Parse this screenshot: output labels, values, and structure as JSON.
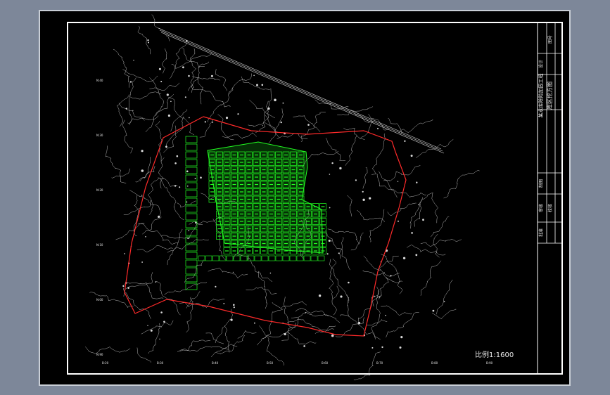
{
  "scale_label": "比例1:1600",
  "title_block": {
    "drawing_title": "库区挖方图",
    "project_name": "某水库除险加固工程",
    "row_labels": [
      "设计",
      "制图",
      "审核",
      "校核",
      "批准"
    ],
    "doc_no": "图号"
  },
  "axis": {
    "left_ticks": [
      "N:40",
      "N:30",
      "N:20",
      "N:10",
      "N:00",
      "N:90"
    ],
    "bottom_ticks": [
      "B:20",
      "B:30",
      "B:40",
      "B:50",
      "B:60",
      "B:70",
      "B:80",
      "B:90"
    ]
  },
  "colors": {
    "background": "#000000",
    "outer_bg": "#7d8799",
    "border": "#ffffff",
    "contour": "#d8d8d8",
    "excavation_grid": "#22ff22",
    "boundary": "#ff2a2a"
  }
}
